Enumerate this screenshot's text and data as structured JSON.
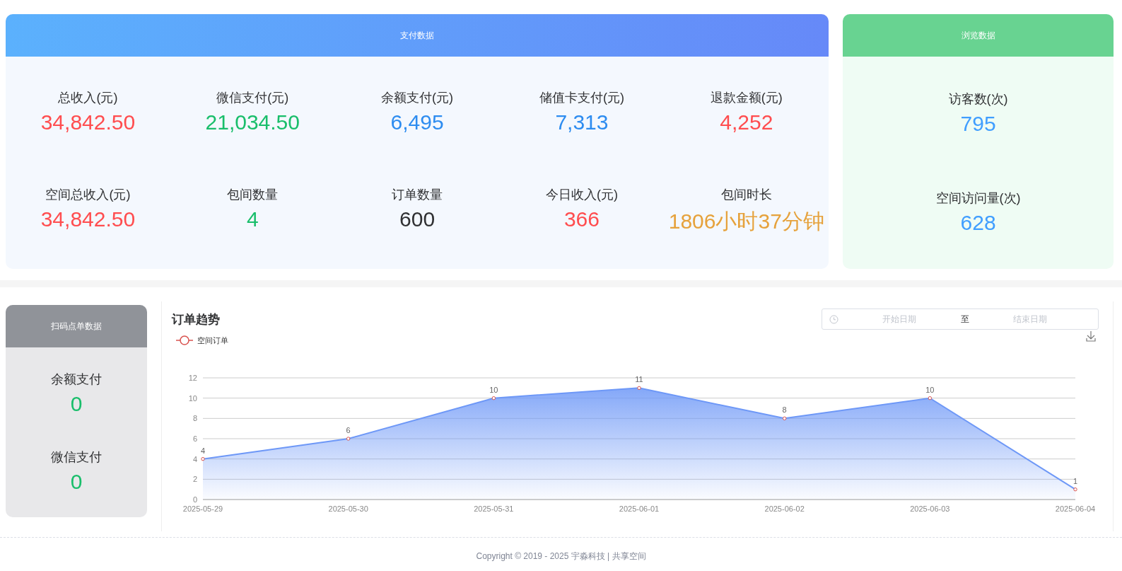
{
  "payment_panel": {
    "title": "支付数据",
    "stats": [
      {
        "label": "总收入(元)",
        "value": "34,842.50",
        "color": "#ff4d4f"
      },
      {
        "label": "微信支付(元)",
        "value": "21,034.50",
        "color": "#19be6b"
      },
      {
        "label": "余额支付(元)",
        "value": "6,495",
        "color": "#2d8cf0"
      },
      {
        "label": "储值卡支付(元)",
        "value": "7,313",
        "color": "#2d8cf0"
      },
      {
        "label": "退款金额(元)",
        "value": "4,252",
        "color": "#ff4d4f"
      },
      {
        "label": "空间总收入(元)",
        "value": "34,842.50",
        "color": "#ff4d4f"
      },
      {
        "label": "包间数量",
        "value": "4",
        "color": "#19be6b"
      },
      {
        "label": "订单数量",
        "value": "600",
        "color": "#303133"
      },
      {
        "label": "今日收入(元)",
        "value": "366",
        "color": "#ff4d4f"
      },
      {
        "label": "包间时长",
        "value": "1806小时37分钟",
        "color": "#e6a23c"
      }
    ]
  },
  "browse_panel": {
    "title": "浏览数据",
    "stats": [
      {
        "label": "访客数(次)",
        "value": "795",
        "color": "#409eff"
      },
      {
        "label": "空间访问量(次)",
        "value": "628",
        "color": "#409eff"
      }
    ]
  },
  "scan_panel": {
    "title": "扫码点单数据",
    "stats": [
      {
        "label": "余额支付",
        "value": "0",
        "color": "#19be6b"
      },
      {
        "label": "微信支付",
        "value": "0",
        "color": "#19be6b"
      }
    ]
  },
  "order_trend": {
    "title": "订单趋势",
    "date_range": {
      "start_placeholder": "开始日期",
      "separator": "至",
      "end_placeholder": "结束日期"
    },
    "chart_data": {
      "type": "area",
      "categories": [
        "2025-05-29",
        "2025-05-30",
        "2025-05-31",
        "2025-06-01",
        "2025-06-02",
        "2025-06-03",
        "2025-06-04"
      ],
      "series": [
        {
          "name": "空间订单",
          "color": "#6e98f7",
          "values": [
            4,
            6,
            10,
            11,
            8,
            10,
            1
          ]
        }
      ],
      "ylim": [
        0,
        12
      ],
      "yticks": [
        0,
        2,
        4,
        6,
        8,
        10,
        12
      ],
      "data_labels": true,
      "grid": true
    }
  },
  "footer": {
    "copyright": "Copyright © 2019 - 2025 宇淼科技 | 共享空间"
  }
}
